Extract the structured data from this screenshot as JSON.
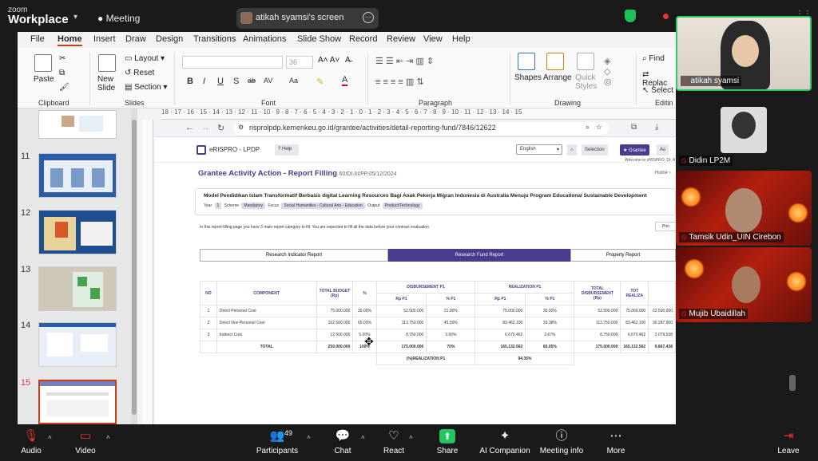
{
  "zoom": {
    "logo_small": "zoom",
    "logo_big": "Workplace",
    "meeting_label": "Meeting",
    "screen_share_label": "atikah syamsi's screen",
    "recording_label": "Re",
    "top_right_fragment": "…"
  },
  "ppt": {
    "menu": [
      "File",
      "Home",
      "Insert",
      "Draw",
      "Design",
      "Transitions",
      "Animations",
      "Slide Show",
      "Record",
      "Review",
      "View",
      "Help"
    ],
    "ribbon": {
      "paste": "Paste",
      "clipboard": "Clipboard",
      "new_slide": "New Slide",
      "layout": "Layout",
      "reset": "Reset",
      "section": "Section",
      "slides": "Slides",
      "font_size": "36",
      "font": "Font",
      "paragraph": "Paragraph",
      "shapes": "Shapes",
      "arrange": "Arrange",
      "quick_styles": "Quick Styles",
      "drawing": "Drawing",
      "find": "Find",
      "replace": "Replac",
      "select": "Select",
      "editing": "Editin"
    },
    "thumbnails": [
      {
        "num": "11"
      },
      {
        "num": "12"
      },
      {
        "num": "13"
      },
      {
        "num": "14"
      },
      {
        "num": "15"
      }
    ],
    "ruler": "18 · 17 · 16 · 15 · 14 · 13 · 12 · 11 · 10 · 9 · 8 · 7 · 6 · 5 · 4 · 3 · 2 · 1 · 0 · 1 · 2 · 3 · 4 · 5 · 6 · 7 · 8 · 9 · 10 · 11 · 12 · 13 · 14 · 15"
  },
  "browser": {
    "url": "risprolpdp.kemenkeu.go.id/grantee/activities/detail-reporting-fund/7846/12622",
    "site_name": "eRISPRO - LPDP",
    "help": "Help",
    "language": "English",
    "selection": "Selection",
    "grantee": "Grantee",
    "as_fragment": "As",
    "welcome": "Welcome to eRISPRO, Dr. AT",
    "page_title": "Grantee Activity Action - Report Filling",
    "page_code": "60/DI.III/PP.05/12/2024",
    "breadcrumb": "Home",
    "research_title": "Model Pendidikan Islam Transformatif Berbasis digital Learning Resources Bagi Anak Pekerja Migran Indonesia di Australia Menuju Program Educational Sustainable Development",
    "meta": {
      "year_label": "Year",
      "year": "1",
      "scheme_label": "Scheme",
      "scheme": "Mandatory",
      "focus_label": "Focus",
      "focus": "Social Humanities - Cultural Arts - Education",
      "output_label": "Output",
      "output": "Product/Technology"
    },
    "notice": "In this report filling page you have 3 main report category to fill. You are expected to fill all the data before your contract evaluation",
    "print": "Prin",
    "tabs": [
      "Research Indicator Report",
      "Research Fund Report",
      "Property Report"
    ],
    "table": {
      "group_headers": {
        "disbursement": "DISBURSEMENT P1",
        "realization": "REALIZATION P1"
      },
      "headers": {
        "no": "NO",
        "component": "COMPONENT",
        "total_budget": "TOTAL BUDGET (Rp)",
        "pct": "%",
        "rp_p1": "Rp P1",
        "pct_p1": "% P1",
        "real_rp_p1": "Rp P1",
        "real_pct_p1": "% P1",
        "total_disbursement": "TOTAL DISBURSEMENT (Rp)",
        "total_realization": "TOT REALIZA"
      },
      "rows": [
        {
          "no": "1",
          "component": "Direct Personel Cost",
          "budget": "75.000.000",
          "pct": "30.00%",
          "dis_rp": "52.500.000",
          "dis_pct": "21.00%",
          "real_rp": "75.000.000",
          "real_pct": "30.00%",
          "tot_dis": "52.500.000",
          "tot_real": "75.000.000",
          "extra": "-22.500.000"
        },
        {
          "no": "2",
          "component": "Direct Non Personel Cost",
          "budget": "162.500.000",
          "pct": "65.00%",
          "dis_rp": "113.750.000",
          "dis_pct": "45.50%",
          "real_rp": "83.462.100",
          "real_pct": "33.38%",
          "tot_dis": "113.750.000",
          "tot_real": "83.462.100",
          "extra": "30.287.900"
        },
        {
          "no": "3",
          "component": "Indirect Cost",
          "budget": "12.500.000",
          "pct": "5.00%",
          "dis_rp": "8.750.000",
          "dis_pct": "3.50%",
          "real_rp": "6.670.462",
          "real_pct": "2.67%",
          "tot_dis": "8.750.000",
          "tot_real": "6.670.462",
          "extra": "2.079.538"
        }
      ],
      "total": {
        "label": "TOTAL",
        "budget": "250.000.000",
        "pct": "100%",
        "dis_rp": "175.000.000",
        "dis_pct": "70%",
        "real_rp": "165.132.562",
        "real_pct": "66.05%",
        "tot_dis": "175.000.000",
        "tot_real": "165.132.562",
        "extra": "9.867.438"
      },
      "realization_label": "(%)REALIZATION P1",
      "realization_value": "94.36%"
    }
  },
  "participants": [
    {
      "name": "atikah syamsi"
    },
    {
      "name": "Didin LP2M"
    },
    {
      "name": "Tamsik Udin_UIN Cirebon"
    },
    {
      "name": "Mujib Ubaidillah"
    }
  ],
  "bottom_bar": {
    "audio": "Audio",
    "video": "Video",
    "participants": "Participants",
    "participants_count": "49",
    "chat": "Chat",
    "react": "React",
    "share": "Share",
    "ai_companion": "AI Companion",
    "meeting_info": "Meeting info",
    "more": "More",
    "leave": "Leave"
  },
  "colors": {
    "accent": "#4a3c8c",
    "ppt_accent": "#c43e1c",
    "zoom_green": "#22c55e",
    "leave_red": "#e33"
  }
}
